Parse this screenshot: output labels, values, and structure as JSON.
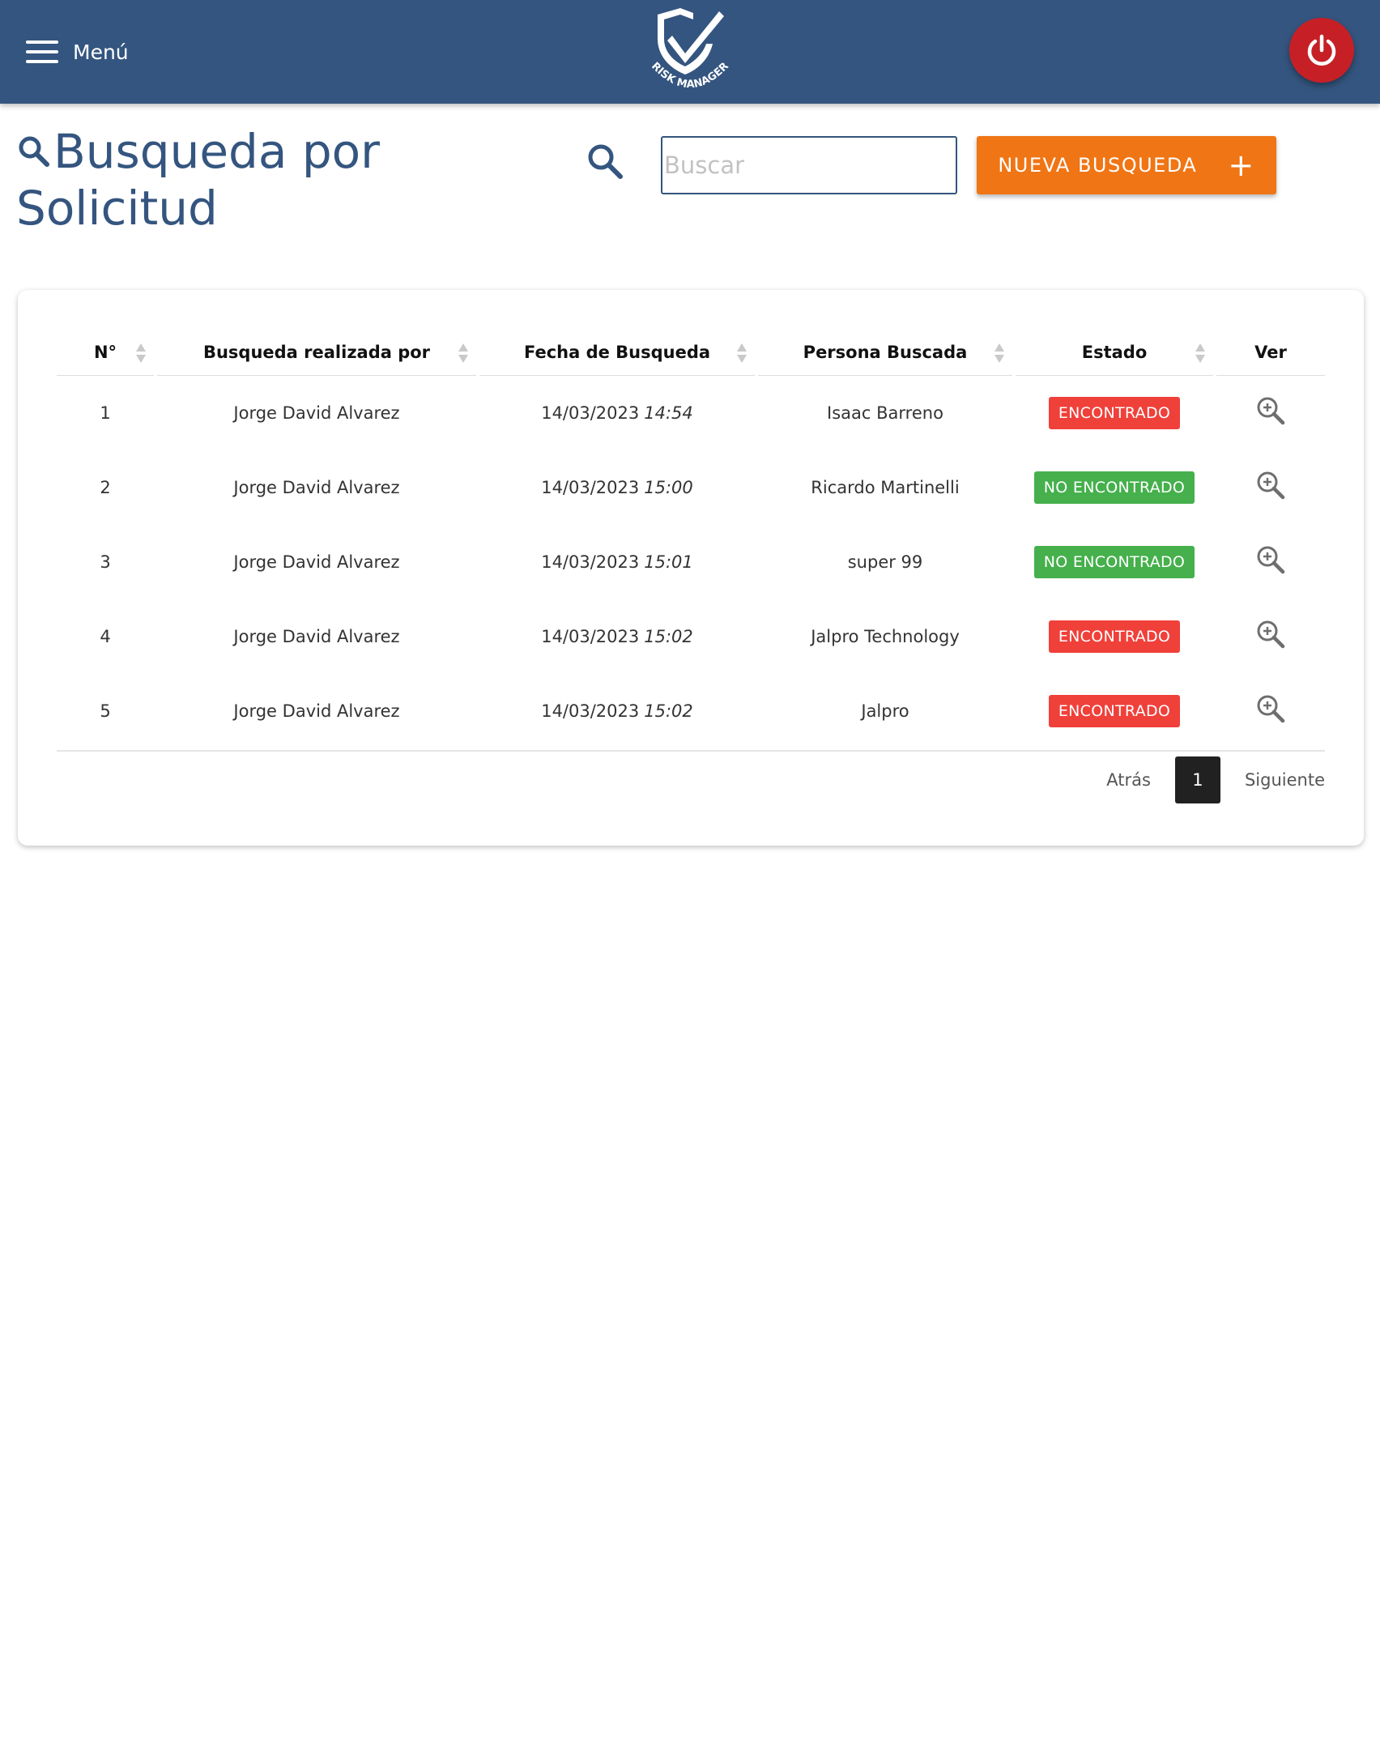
{
  "header": {
    "menu_label": "Menú",
    "logo_text": "RISK MANAGER",
    "brand_color": "#34557f",
    "power_color": "#c62026"
  },
  "page": {
    "title": "Busqueda por Solicitud",
    "search_placeholder": "Buscar",
    "search_value": "",
    "new_search_label": "NUEVA BUSQUEDA",
    "new_search_color": "#f07514"
  },
  "table": {
    "columns": [
      "N°",
      "Busqueda realizada por",
      "Fecha de Busqueda",
      "Persona Buscada",
      "Estado",
      "Ver"
    ],
    "rows": [
      {
        "num": "1",
        "user": "Jorge David Alvarez",
        "date": "14/03/2023",
        "time": "14:54",
        "person": "Isaac Barreno",
        "status": "ENCONTRADO",
        "status_color": "#f0403a"
      },
      {
        "num": "2",
        "user": "Jorge David Alvarez",
        "date": "14/03/2023",
        "time": "15:00",
        "person": "Ricardo Martinelli",
        "status": "NO ENCONTRADO",
        "status_color": "#45b04c"
      },
      {
        "num": "3",
        "user": "Jorge David Alvarez",
        "date": "14/03/2023",
        "time": "15:01",
        "person": "super 99",
        "status": "NO ENCONTRADO",
        "status_color": "#45b04c"
      },
      {
        "num": "4",
        "user": "Jorge David Alvarez",
        "date": "14/03/2023",
        "time": "15:02",
        "person": "Jalpro Technology",
        "status": "ENCONTRADO",
        "status_color": "#f0403a"
      },
      {
        "num": "5",
        "user": "Jorge David Alvarez",
        "date": "14/03/2023",
        "time": "15:02",
        "person": "Jalpro",
        "status": "ENCONTRADO",
        "status_color": "#f0403a"
      }
    ]
  },
  "pagination": {
    "prev_label": "Atrás",
    "current_page": "1",
    "next_label": "Siguiente"
  }
}
